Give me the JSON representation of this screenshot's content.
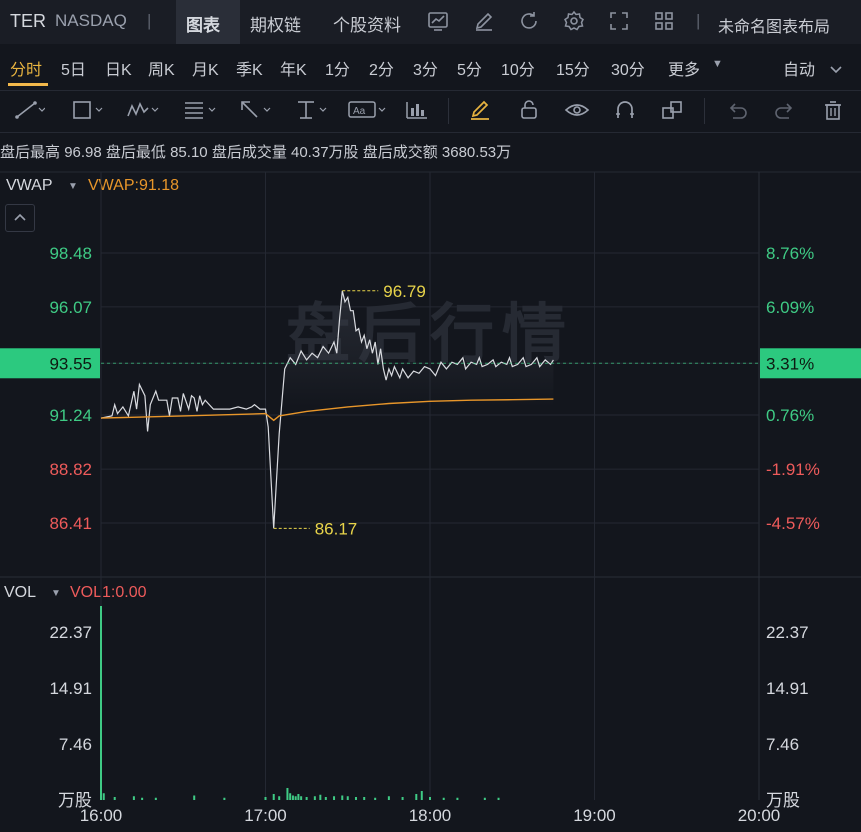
{
  "header": {
    "ticker": "TER",
    "exchange": "NASDAQ",
    "divider": "|",
    "tabs": [
      "图表",
      "期权链",
      "个股资料"
    ],
    "active_tab": "图表",
    "layout_name": "未命名图表布局"
  },
  "icons": [
    "chart-line-icon",
    "edit-icon",
    "refresh-icon",
    "gear-icon",
    "fullscreen-icon",
    "grid-layout-icon"
  ],
  "periods": [
    "分时",
    "5日",
    "日K",
    "周K",
    "月K",
    "季K",
    "年K",
    "1分",
    "2分",
    "3分",
    "5分",
    "10分",
    "15分",
    "30分",
    "更多"
  ],
  "active_period": "分时",
  "scale_mode": "自动",
  "stats": {
    "label1": "盘后最高",
    "value1": "96.98",
    "label2": "盘后最低",
    "value2": "85.10",
    "label3": "盘后成交量",
    "value3": "40.37万股",
    "label4": "盘后成交额",
    "value4": "3680.53万"
  },
  "indicator": {
    "name": "VWAP",
    "value_text": "VWAP:91.18"
  },
  "watermark": "盘后行情",
  "vol_indicator": {
    "name": "VOL",
    "value_text": "VOL1:0.00"
  },
  "colors": {
    "price_line": "#d9dbe0",
    "vwap_line": "#e8962a",
    "up": "#3fcb85",
    "down": "#ee5b5b",
    "label": "#e8d44a"
  },
  "chart_data": [
    {
      "type": "line",
      "x_range": [
        "16:00",
        "20:00"
      ],
      "x_ticks": [
        "16:00",
        "17:00",
        "18:00",
        "19:00",
        "20:00"
      ],
      "y_ticks_left": [
        "98.48",
        "96.07",
        "93.55",
        "91.24",
        "88.82",
        "86.41"
      ],
      "y_ticks_right": [
        "8.76%",
        "6.09%",
        "3.31%",
        "0.76%",
        "-1.91%",
        "-4.57%"
      ],
      "current_price": "93.55",
      "current_pct": "3.31%",
      "high_label": "96.79",
      "low_label": "86.17",
      "ylim": [
        85.1,
        99.3
      ],
      "series": [
        {
          "name": "Price",
          "points": [
            [
              "16:00",
              91.1
            ],
            [
              "16:04",
              91.2
            ],
            [
              "16:05",
              91.7
            ],
            [
              "16:06",
              91.3
            ],
            [
              "16:08",
              91.6
            ],
            [
              "16:10",
              91.2
            ],
            [
              "16:12",
              92.3
            ],
            [
              "16:13",
              91.5
            ],
            [
              "16:14",
              92.6
            ],
            [
              "16:16",
              92.1
            ],
            [
              "16:17",
              90.5
            ],
            [
              "16:18",
              91.7
            ],
            [
              "16:20",
              92.3
            ],
            [
              "16:21",
              91.9
            ],
            [
              "16:24",
              91.9
            ],
            [
              "16:25",
              91.2
            ],
            [
              "16:26",
              92.0
            ],
            [
              "16:28",
              92.0
            ],
            [
              "16:29",
              91.4
            ],
            [
              "16:30",
              92.2
            ],
            [
              "16:32",
              91.5
            ],
            [
              "16:33",
              92.1
            ],
            [
              "16:34",
              92.0
            ],
            [
              "16:35",
              91.4
            ],
            [
              "16:36",
              92.1
            ],
            [
              "16:37",
              91.7
            ],
            [
              "16:38",
              91.9
            ],
            [
              "16:41",
              91.5
            ],
            [
              "16:44",
              91.5
            ],
            [
              "16:47",
              91.5
            ],
            [
              "16:50",
              91.6
            ],
            [
              "16:53",
              91.5
            ],
            [
              "16:55",
              91.6
            ],
            [
              "16:56",
              91.7
            ],
            [
              "16:58",
              91.5
            ],
            [
              "17:00",
              91.5
            ],
            [
              "17:01",
              90.7
            ],
            [
              "17:03",
              86.17
            ],
            [
              "17:05",
              90.4
            ],
            [
              "17:07",
              93.3
            ],
            [
              "17:09",
              93.8
            ],
            [
              "17:11",
              93.5
            ],
            [
              "17:13",
              94.1
            ],
            [
              "17:15",
              93.7
            ],
            [
              "17:17",
              94.0
            ],
            [
              "17:19",
              93.8
            ],
            [
              "17:21",
              94.3
            ],
            [
              "17:23",
              94.0
            ],
            [
              "17:25",
              94.5
            ],
            [
              "17:26",
              94.0
            ],
            [
              "17:27",
              95.5
            ],
            [
              "17:28",
              96.79
            ],
            [
              "17:29",
              96.3
            ],
            [
              "17:30",
              96.5
            ],
            [
              "17:31",
              95.9
            ],
            [
              "17:32",
              95.9
            ],
            [
              "17:33",
              95.0
            ],
            [
              "17:34",
              95.1
            ],
            [
              "17:35",
              94.5
            ],
            [
              "17:36",
              94.8
            ],
            [
              "17:37",
              94.2
            ],
            [
              "17:38",
              94.6
            ],
            [
              "17:39",
              94.0
            ],
            [
              "17:40",
              94.5
            ],
            [
              "17:41",
              93.5
            ],
            [
              "17:42",
              94.2
            ],
            [
              "17:43",
              93.3
            ],
            [
              "17:44",
              92.8
            ],
            [
              "17:45",
              93.3
            ],
            [
              "17:46",
              93.0
            ],
            [
              "17:47",
              93.4
            ],
            [
              "17:49",
              92.9
            ],
            [
              "17:50",
              93.3
            ],
            [
              "17:52",
              92.9
            ],
            [
              "17:54",
              93.2
            ],
            [
              "17:56",
              93.1
            ],
            [
              "17:58",
              93.4
            ],
            [
              "18:00",
              93.3
            ],
            [
              "18:02",
              93.0
            ],
            [
              "18:04",
              93.6
            ],
            [
              "18:06",
              93.3
            ],
            [
              "18:08",
              93.6
            ],
            [
              "18:10",
              93.5
            ],
            [
              "18:12",
              93.8
            ],
            [
              "18:13",
              93.3
            ],
            [
              "18:15",
              93.6
            ],
            [
              "18:17",
              93.5
            ],
            [
              "18:18",
              93.8
            ],
            [
              "18:19",
              93.4
            ],
            [
              "18:21",
              93.5
            ],
            [
              "18:23",
              93.7
            ],
            [
              "18:24",
              93.4
            ],
            [
              "18:26",
              93.6
            ],
            [
              "18:28",
              93.5
            ],
            [
              "18:29",
              93.8
            ],
            [
              "18:30",
              93.4
            ],
            [
              "18:32",
              93.5
            ],
            [
              "18:34",
              93.8
            ],
            [
              "18:35",
              93.4
            ],
            [
              "18:37",
              93.5
            ],
            [
              "18:39",
              93.8
            ],
            [
              "18:40",
              93.4
            ],
            [
              "18:42",
              93.7
            ],
            [
              "18:44",
              93.5
            ],
            [
              "18:45",
              93.7
            ]
          ]
        },
        {
          "name": "VWAP",
          "points": [
            [
              "16:00",
              91.1
            ],
            [
              "16:30",
              91.2
            ],
            [
              "17:00",
              91.3
            ],
            [
              "17:03",
              91.0
            ],
            [
              "17:05",
              91.2
            ],
            [
              "17:15",
              91.4
            ],
            [
              "17:30",
              91.6
            ],
            [
              "17:45",
              91.75
            ],
            [
              "18:00",
              91.85
            ],
            [
              "18:15",
              91.9
            ],
            [
              "18:30",
              91.92
            ],
            [
              "18:45",
              91.95
            ]
          ]
        }
      ]
    },
    {
      "type": "bar",
      "x_range": [
        "16:00",
        "20:00"
      ],
      "y_ticks_left": [
        "22.37",
        "14.91",
        "7.46",
        "万股"
      ],
      "y_ticks_right": [
        "22.37",
        "14.91",
        "7.46",
        "万股"
      ],
      "ylim": [
        0,
        29.8
      ],
      "unit": "万股",
      "series": [
        {
          "name": "VOL",
          "points": [
            [
              "16:00",
              29.8
            ],
            [
              "16:01",
              0.9
            ],
            [
              "16:05",
              0.4
            ],
            [
              "16:12",
              0.5
            ],
            [
              "16:15",
              0.3
            ],
            [
              "16:20",
              0.3
            ],
            [
              "16:34",
              0.6
            ],
            [
              "16:45",
              0.3
            ],
            [
              "17:00",
              0.4
            ],
            [
              "17:03",
              0.8
            ],
            [
              "17:05",
              0.5
            ],
            [
              "17:08",
              1.6
            ],
            [
              "17:09",
              0.9
            ],
            [
              "17:10",
              0.6
            ],
            [
              "17:11",
              0.5
            ],
            [
              "17:12",
              0.8
            ],
            [
              "17:13",
              0.5
            ],
            [
              "17:15",
              0.4
            ],
            [
              "17:18",
              0.5
            ],
            [
              "17:20",
              0.7
            ],
            [
              "17:22",
              0.4
            ],
            [
              "17:25",
              0.5
            ],
            [
              "17:28",
              0.6
            ],
            [
              "17:30",
              0.5
            ],
            [
              "17:33",
              0.4
            ],
            [
              "17:36",
              0.4
            ],
            [
              "17:40",
              0.3
            ],
            [
              "17:45",
              0.5
            ],
            [
              "17:50",
              0.4
            ],
            [
              "17:55",
              0.8
            ],
            [
              "17:57",
              1.2
            ],
            [
              "18:00",
              0.4
            ],
            [
              "18:05",
              0.3
            ],
            [
              "18:10",
              0.3
            ],
            [
              "18:20",
              0.3
            ],
            [
              "18:25",
              0.3
            ]
          ]
        }
      ]
    }
  ]
}
